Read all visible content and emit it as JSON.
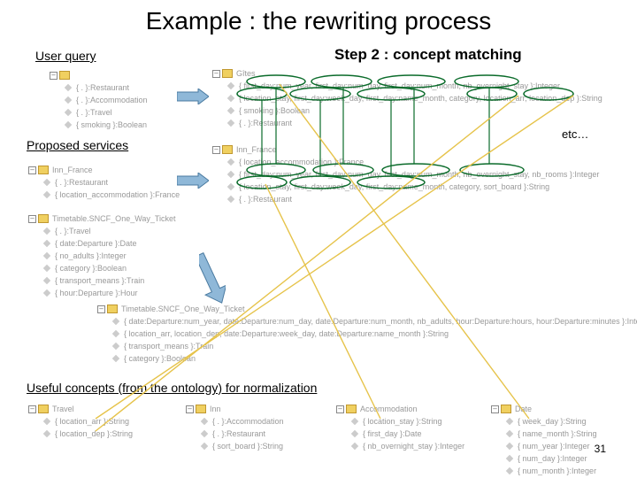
{
  "title": "Example  : the rewriting process",
  "step_label": "Step 2 : concept matching",
  "labels": {
    "user_query": "User query",
    "proposed_services": "Proposed  services",
    "useful_concepts": "Useful concepts (from the ontology) for normalization"
  },
  "etc": "etc…",
  "pagenum": "31",
  "user_query_tree": {
    "root": "",
    "items": [
      "{ . }:Restaurant",
      "{ . }:Accommodation",
      "{ . }:Travel",
      "{ smoking }:Boolean"
    ]
  },
  "gites_tree": {
    "root": "Gîtes",
    "items": [
      "{ first_day:num_year, first_day:num_day, first_day:num_month, nb_overnight_stay }:Integer",
      "{ location_stay, first_day:week_day, first_day:name_month, category, location_arr, location_dep }:String",
      "{ smoking }:Boolean",
      "{ . }:Restaurant"
    ]
  },
  "inn_france_small": {
    "root": "Inn_France",
    "items": [
      "{ . }:Restaurant",
      "{ location_accommodation }:France"
    ]
  },
  "inn_france_large": {
    "root": "Inn_France",
    "items": [
      "{ location_accommodation }:France",
      "{ first_day:num_year, first_day:num_day, first_day:num_month, nb_overnight_stay, nb_rooms }:Integer",
      "{ location_stay, first_day:week_day, first_day:name_month, category, sort_board }:String",
      "{ . }:Restaurant"
    ]
  },
  "timetable_small": {
    "root": "Timetable.SNCF_One_Way_Ticket",
    "items": [
      "{ . }:Travel",
      "{ date:Departure }:Date",
      "{ no_adults }:Integer",
      "{ category }:Boolean",
      "{ transport_means }:Train",
      "{ hour:Departure }:Hour"
    ]
  },
  "timetable_large": {
    "root": "Timetable.SNCF_One_Way_Ticket",
    "items": [
      "{ date:Departure:num_year, date:Departure:num_day, date:Departure:num_month, nb_adults, hour:Departure:hours, hour:Departure:minutes }:Integer",
      "{ location_arr, location_dep, date:Departure:week_day, date:Departure:name_month }:String",
      "{ transport_means }:Train",
      "{ category }:Boolean"
    ]
  },
  "ontology": {
    "travel": {
      "root": "Travel",
      "items": [
        "{ location_arr }:String",
        "{ location_dep }:String"
      ]
    },
    "inn": {
      "root": "Inn",
      "items": [
        "{ . }:Accommodation",
        "{ . }:Restaurant",
        "{ sort_board }:String"
      ]
    },
    "accommodation": {
      "root": "Accommodation",
      "items": [
        "{ location_stay }:String",
        "{ first_day }:Date",
        "{ nb_overnight_stay }:Integer"
      ]
    },
    "date": {
      "root": "Date",
      "items": [
        "{ week_day }:String",
        "{ name_month }:String",
        "{ num_year }:Integer",
        "{ num_day }:Integer",
        "{ num_month }:Integer"
      ]
    }
  }
}
